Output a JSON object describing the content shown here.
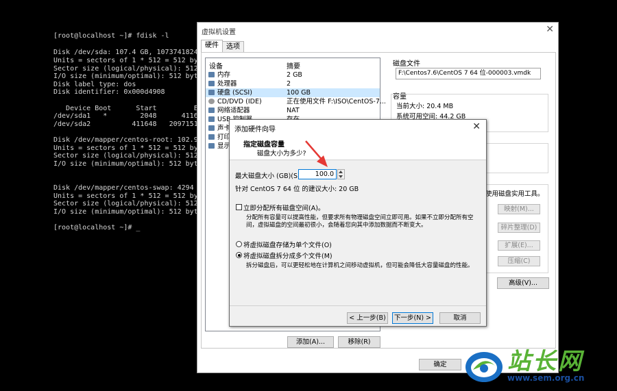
{
  "terminal": {
    "lines": [
      "[root@localhost ~]# fdisk -l",
      "",
      "Disk /dev/sda: 107.4 GB, 10737418240",
      "Units = sectors of 1 * 512 = 512 byt",
      "Sector size (logical/physical): 512",
      "I/O size (minimum/optimal): 512 byte",
      "Disk label type: dos",
      "Disk identifier: 0x000d4908",
      "",
      "   Device Boot      Start         En",
      "/dev/sda1   *        2048      41164",
      "/dev/sda2          411648   20971519",
      "",
      "Disk /dev/mapper/centos-root: 102.9",
      "Units = sectors of 1 * 512 = 512 byt",
      "Sector size (logical/physical): 512",
      "I/O size (minimum/optimal): 512 byte",
      "",
      "",
      "Disk /dev/mapper/centos-swap: 4294 M",
      "Units = sectors of 1 * 512 = 512 byt",
      "Sector size (logical/physical): 512",
      "I/O size (minimum/optimal): 512 byte",
      "",
      "[root@localhost ~]# _"
    ]
  },
  "vm_settings": {
    "title": "虚拟机设置",
    "close": "✕",
    "tabs": [
      "硬件",
      "选项"
    ],
    "device_header": "设备",
    "summary_header": "摘要",
    "devices": [
      {
        "name": "内存",
        "summary": "2 GB"
      },
      {
        "name": "处理器",
        "summary": "2"
      },
      {
        "name": "硬盘 (SCSI)",
        "summary": "100 GB"
      },
      {
        "name": "CD/DVD (IDE)",
        "summary": "正在使用文件 F:\\ISO\\CentOS-7..."
      },
      {
        "name": "网络适配器",
        "summary": "NAT"
      },
      {
        "name": "USB 控制器",
        "summary": "存在"
      },
      {
        "name": "声卡",
        "summary": ""
      },
      {
        "name": "打印",
        "summary": ""
      },
      {
        "name": "显示",
        "summary": ""
      }
    ],
    "disk_file_label": "磁盘文件",
    "disk_file_value": "F:\\Centos7.6\\CentOS 7 64 位-000003.vmdk",
    "capacity_label": "容量",
    "current_size": "当前大小: 20.4 MB",
    "system_free": "系统可用空间: 44.2 GB",
    "utility_text": "使用磁盘实用工具。",
    "utility_buttons": [
      "映射(M)...",
      "碎片整理(D)",
      "扩展(E)...",
      "压缩(C)"
    ],
    "advanced_button": "高级(V)...",
    "add_button": "添加(A)...",
    "remove_button": "移除(R)",
    "ok_button": "确定"
  },
  "wizard": {
    "title": "添加硬件向导",
    "close": "✕",
    "heading": "指定磁盘容量",
    "subheading": "磁盘大小为多少?",
    "max_size_label": "最大磁盘大小 (GB)(S):",
    "max_size_value": "100.0",
    "recommended": "针对 CentOS 7 64 位 的建议大小: 20 GB",
    "allocate_label": "立即分配所有磁盘空间(A)。",
    "allocate_desc_1": "分配所有容量可以提高性能，但要求所有物理磁盘空间立即可用。如果不立即分配所有空",
    "allocate_desc_2": "间，虚拟磁盘的空间最初很小，会随着您向其中添加数据而不断变大。",
    "single_file_label": "将虚拟磁盘存储为单个文件(O)",
    "split_file_label": "将虚拟磁盘拆分成多个文件(M)",
    "split_desc": "拆分磁盘后，可以更轻松地在计算机之间移动虚拟机，但可能会降低大容量磁盘的性能。",
    "back_button": "< 上一步(B)",
    "next_button": "下一步(N) >",
    "cancel_button": "取消"
  },
  "watermark": {
    "text": "站长网",
    "url": "www.sem.org.cn"
  },
  "colors": {
    "selection": "#cce8ff",
    "focus_border": "#0078d7",
    "arrow": "#e53935",
    "logo_green": "#59b336",
    "logo_blue": "#1a4fa0"
  }
}
